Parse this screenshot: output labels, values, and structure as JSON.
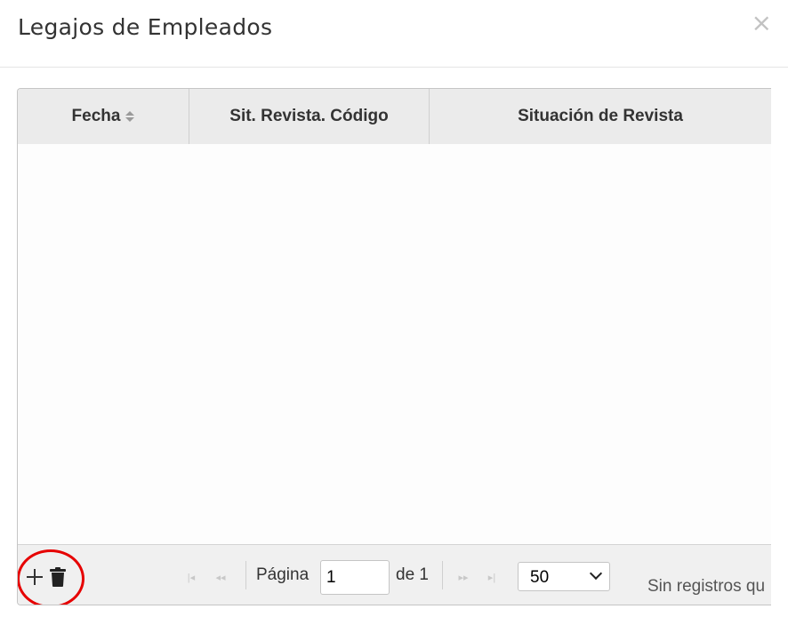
{
  "modal": {
    "title": "Legajos de Empleados",
    "close_glyph": "×",
    "close_icon": "close-icon"
  },
  "grid": {
    "columns": [
      {
        "label": "Fecha",
        "sortable": true
      },
      {
        "label": "Sit. Revista. Código",
        "sortable": false
      },
      {
        "label": "Situación de Revista",
        "sortable": false
      }
    ],
    "rows": []
  },
  "toolbar": {
    "add_icon": "plus-icon",
    "delete_icon": "trash-icon",
    "highlight_color": "#e60000"
  },
  "pager": {
    "page_label": "Página",
    "current_page": "1",
    "of_label": "de 1",
    "page_size": "50",
    "status": "Sin registros qu"
  }
}
